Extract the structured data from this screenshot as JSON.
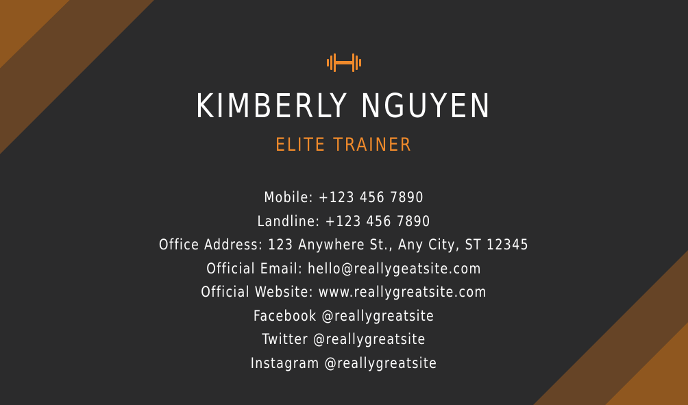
{
  "card": {
    "logo_icon": "dumbbell-icon",
    "name": "KIMBERLY NGUYEN",
    "role": "ELITE TRAINER",
    "details": [
      "Mobile: +123 456 7890",
      "Landline: +123 456 7890",
      "Office Address: 123 Anywhere St., Any City, ST 12345",
      "Official Email: hello@reallygeatsite.com",
      "Official Website: www.reallygreatsite.com",
      "Facebook @reallygreatsite",
      "Twitter @reallygreatsite",
      "Instagram @reallygreatsite"
    ]
  },
  "colors": {
    "background": "#2b2b2c",
    "accent": "#f08a2b",
    "stripe_dark": "#664426",
    "stripe_light": "#8f571f",
    "text": "#ffffff"
  }
}
